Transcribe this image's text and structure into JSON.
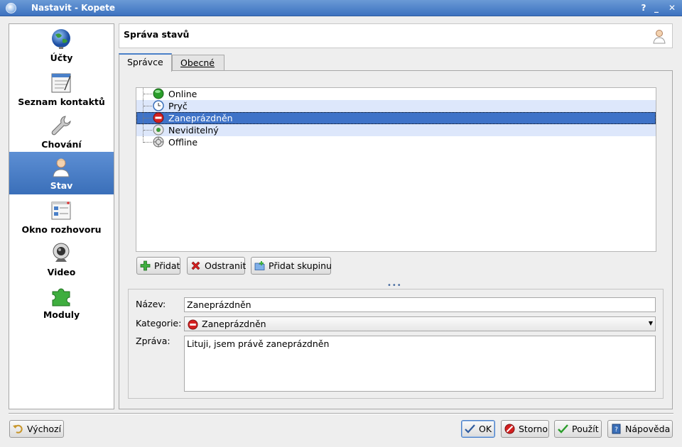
{
  "window": {
    "title": "Nastavit - Kopete",
    "help_glyph": "?",
    "min_glyph": "_",
    "max_glyph": "□",
    "close_glyph": "✕"
  },
  "sidebar": {
    "items": [
      {
        "label": "Účty",
        "icon": "globe-icon"
      },
      {
        "label": "Seznam kontaktů",
        "icon": "contact-list-icon"
      },
      {
        "label": "Chování",
        "icon": "wrench-icon"
      },
      {
        "label": "Stav",
        "icon": "user-icon",
        "selected": true
      },
      {
        "label": "Okno rozhovoru",
        "icon": "chat-window-icon"
      },
      {
        "label": "Video",
        "icon": "webcam-icon"
      },
      {
        "label": "Moduly",
        "icon": "puzzle-icon"
      }
    ]
  },
  "header": {
    "title": "Správa stavů"
  },
  "tabs": [
    {
      "label": "Správce",
      "active": true
    },
    {
      "label": "Obecné",
      "active": false
    }
  ],
  "status_tree": {
    "items": [
      {
        "label": "Online",
        "icon": "online-icon"
      },
      {
        "label": "Pryč",
        "icon": "away-clock-icon"
      },
      {
        "label": "Zaneprázdněn",
        "icon": "busy-icon",
        "selected": true
      },
      {
        "label": "Neviditelný",
        "icon": "invisible-icon"
      },
      {
        "label": "Offline",
        "icon": "offline-icon"
      }
    ]
  },
  "tree_buttons": {
    "add": "Přidat",
    "remove": "Odstranit",
    "add_group": "Přidat skupinu"
  },
  "grip": "•••",
  "editor": {
    "name_label": "Název:",
    "name_value": "Zaneprázdněn",
    "category_label": "Kategorie:",
    "category_value": "Zaneprázdněn",
    "message_label": "Zpráva:",
    "message_value": "Lituji, jsem právě zaneprázdněn"
  },
  "footer": {
    "defaults": "Výchozí",
    "ok": "OK",
    "cancel": "Storno",
    "apply": "Použít",
    "help": "Nápověda"
  },
  "colors": {
    "selection": "#3f73c8",
    "online": "#2a9d2a",
    "busy": "#d42020",
    "accent": "#4a80c8"
  }
}
